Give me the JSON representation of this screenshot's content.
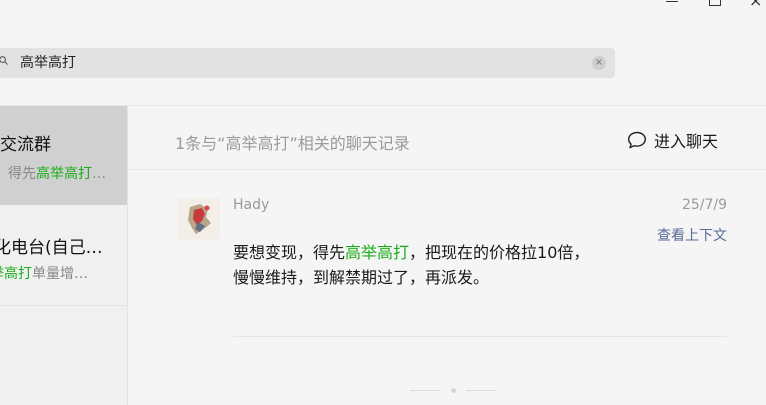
{
  "window": {
    "close_glyph": "×"
  },
  "search": {
    "value": "高举高打",
    "clear_glyph": "×"
  },
  "conversations": [
    {
      "title": "交流群",
      "preview_prefix": "得先",
      "preview_match": "高举高打",
      "preview_suffix": "…"
    },
    {
      "title": "化电台(自己…",
      "preview_prefix": "",
      "preview_match": "举高打",
      "preview_suffix": "单量增…"
    }
  ],
  "results_header": {
    "count_text": "1条与“高举高打”相关的聊天记录",
    "enter_chat_label": "进入聊天"
  },
  "message": {
    "sender": "Hady",
    "date": "25/7/9",
    "context_link": "查看上下文",
    "line1_prefix": "要想变现，得先",
    "line1_match": "高举高打",
    "line1_suffix": "，把现在的价格拉10倍，",
    "line2": "慢慢维持，到解禁期过了，再派发。"
  },
  "colors": {
    "highlight": "#1aad19",
    "link": "#576b95",
    "selected_bg": "#d0d0d0"
  },
  "icons": [
    "search-icon",
    "clear-icon",
    "chat-bubble-icon",
    "minimize-icon",
    "maximize-icon",
    "close-icon"
  ]
}
